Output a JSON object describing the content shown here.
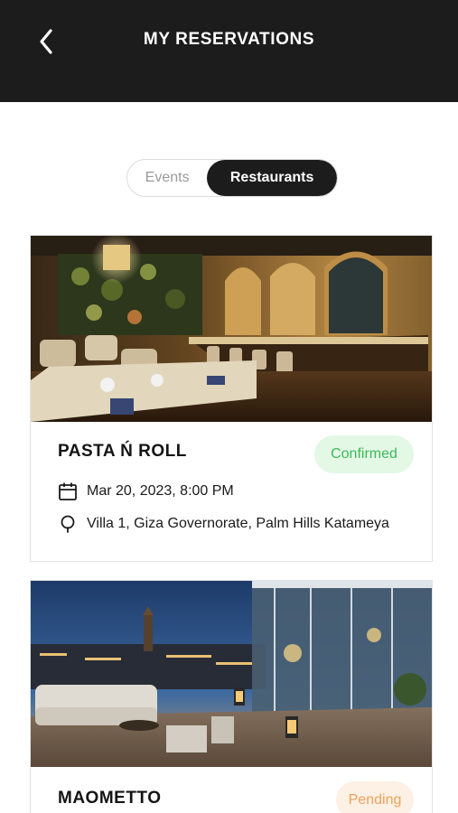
{
  "header": {
    "title": "MY RESERVATIONS",
    "back_icon": "chevron-left-icon"
  },
  "tabs": {
    "items": [
      {
        "label": "Events",
        "active": false
      },
      {
        "label": "Restaurants",
        "active": true
      }
    ]
  },
  "reservations": [
    {
      "name": "PASTA Ń ROLL",
      "status": "Confirmed",
      "status_color": "#3cb85a",
      "datetime": "Mar 20, 2023, 8:00 PM",
      "location": "Villa 1, Giza Governorate, Palm Hills Katameya",
      "photo": "restaurant-interior-photo"
    },
    {
      "name": "MAOMETTO",
      "status": "Pending",
      "status_color": "#f0a25a",
      "photo": "rooftop-terrace-photo"
    }
  ],
  "icons": {
    "calendar": "calendar-icon",
    "location": "location-pin-icon"
  },
  "colors": {
    "header_bg": "#1c1c1c",
    "active_tab_bg": "#1c1c1c",
    "confirmed_bg": "#e4f8e6",
    "pending_bg": "#fdf0e4"
  }
}
